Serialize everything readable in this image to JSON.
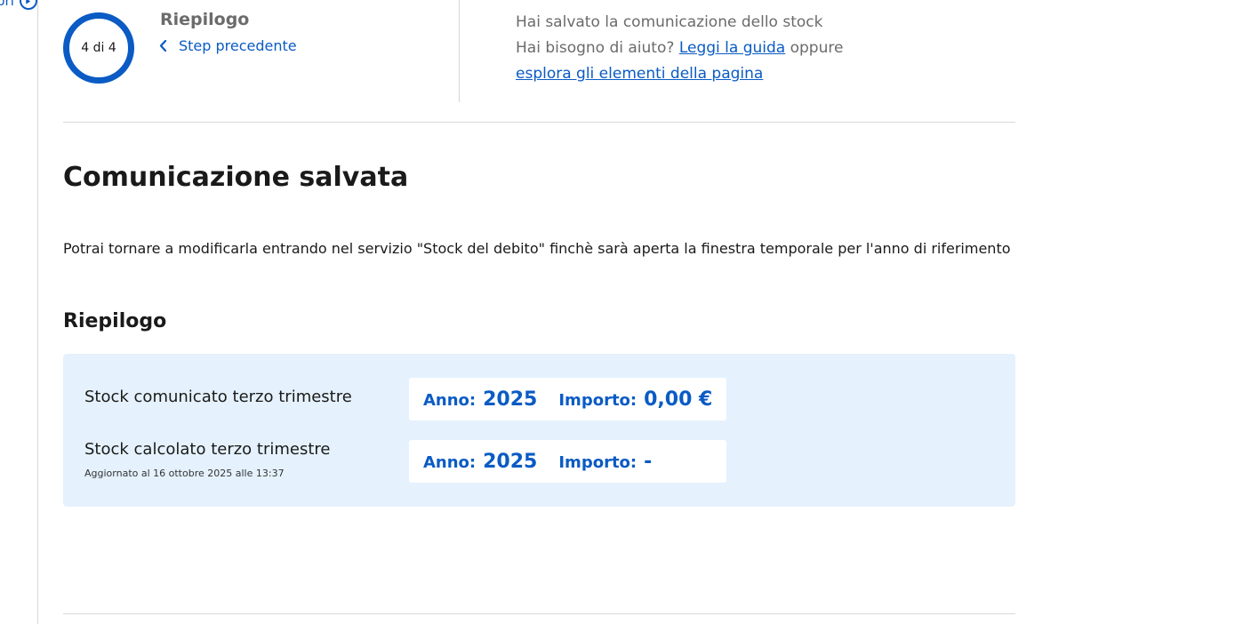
{
  "side_nav": {
    "fragment_text": "pri",
    "icon": "play-circle-icon"
  },
  "stepper": {
    "indicator": "4 di 4",
    "title": "Riepilogo",
    "back_label": "Step precedente",
    "back_icon": "chevron-left-icon"
  },
  "help": {
    "saved_text": "Hai salvato la comunicazione dello stock",
    "need_help_text": "Hai bisogno di aiuto?",
    "guide_link": "Leggi la guida",
    "or_text": "oppure",
    "explore_link": "esplora gli elementi della pagina"
  },
  "main": {
    "title": "Comunicazione salvata",
    "lead": "Potrai tornare a modificarla entrando nel servizio \"Stock del debito\" finchè sarà aperta la finestra temporale per l'anno di riferimento",
    "summary_title": "Riepilogo"
  },
  "summary": {
    "rows": [
      {
        "label": "Stock comunicato terzo trimestre",
        "year_key": "Anno:",
        "year": "2025",
        "amount_key": "Importo:",
        "amount": "0,00 €"
      },
      {
        "label": "Stock calcolato terzo trimestre",
        "note": "Aggiornato al 16 ottobre 2025 alle 13:37",
        "year_key": "Anno:",
        "year": "2025",
        "amount_key": "Importo:",
        "amount": "-"
      }
    ]
  },
  "colors": {
    "accent": "#0a5bc4",
    "summary_background": "#e5f2fd",
    "muted_text": "#6b6b6b"
  }
}
